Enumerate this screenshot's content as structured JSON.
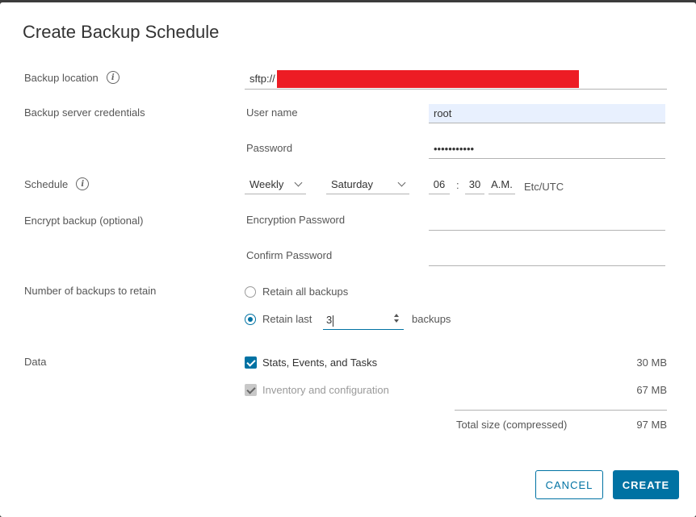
{
  "dialog": {
    "title": "Create Backup Schedule"
  },
  "backup_location": {
    "label": "Backup location",
    "info_icon": "info-icon",
    "value_prefix": "sftp://",
    "redaction_color": "#ed1c24"
  },
  "credentials": {
    "label": "Backup server credentials",
    "username_label": "User name",
    "username_value": "root",
    "password_label": "Password",
    "password_value": "•••••••••••"
  },
  "schedule": {
    "label": "Schedule",
    "info_icon": "info-icon",
    "frequency": "Weekly",
    "day": "Saturday",
    "hour": "06",
    "separator": ":",
    "minute": "30",
    "ampm": "A.M.",
    "timezone": "Etc/UTC"
  },
  "encrypt": {
    "label": "Encrypt backup (optional)",
    "encryption_password_label": "Encryption Password",
    "confirm_password_label": "Confirm Password"
  },
  "retain": {
    "label": "Number of backups to retain",
    "option_all": "Retain all backups",
    "option_last": "Retain last",
    "last_value": "3",
    "suffix": "backups",
    "selected": "last"
  },
  "data": {
    "label": "Data",
    "items": [
      {
        "label": "Stats, Events, and Tasks",
        "size": "30 MB",
        "checked": true,
        "disabled": false
      },
      {
        "label": "Inventory and configuration",
        "size": "67 MB",
        "checked": true,
        "disabled": true
      }
    ],
    "total_label": "Total size (compressed)",
    "total_size": "97 MB"
  },
  "buttons": {
    "cancel": "CANCEL",
    "create": "CREATE"
  },
  "colors": {
    "accent": "#0072a3",
    "autofill": "#e8f0fe"
  }
}
